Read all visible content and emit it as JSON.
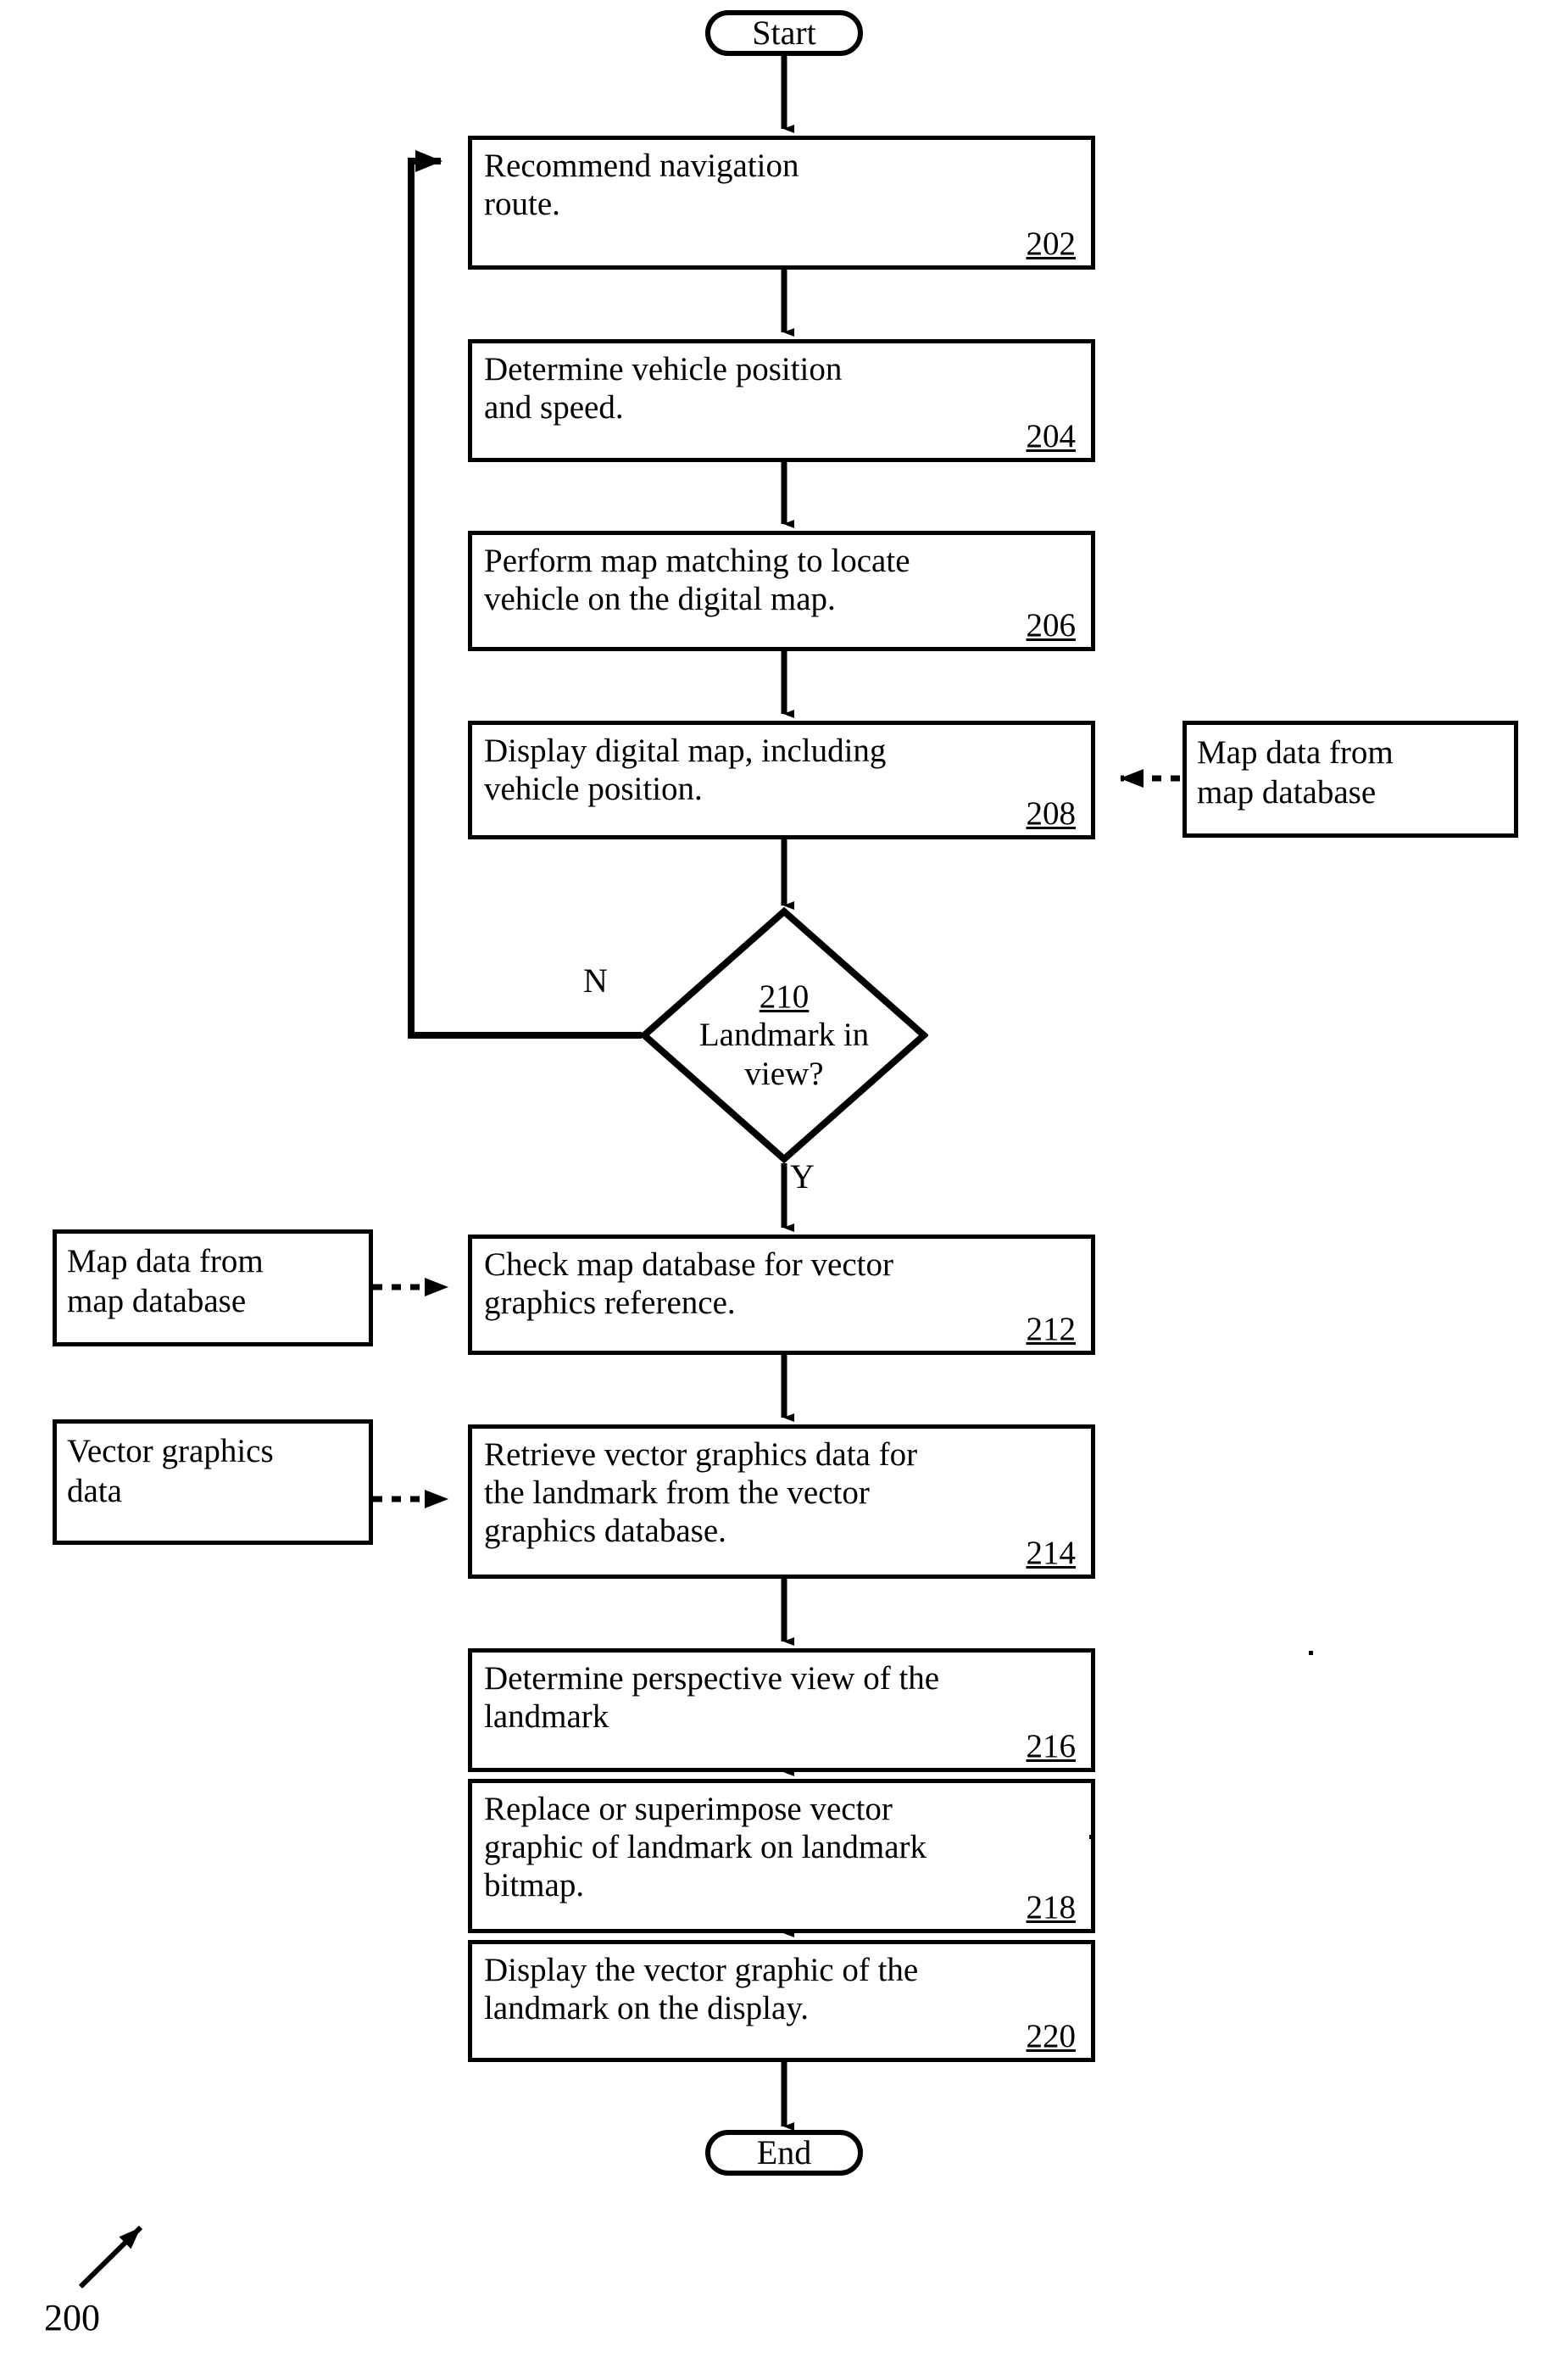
{
  "figure": {
    "label": "200",
    "caption_arrow": "figure-callout-arrow"
  },
  "nodes": {
    "start": {
      "label": "Start",
      "type": "terminator"
    },
    "end": {
      "label": "End",
      "type": "terminator"
    },
    "step202": {
      "text": "Recommend navigation\nroute.",
      "ref": "202",
      "type": "process"
    },
    "step204": {
      "text": "Determine vehicle position\nand speed.",
      "ref": "204",
      "type": "process"
    },
    "step206": {
      "text": "Perform map matching to locate\nvehicle on the digital map.",
      "ref": "206",
      "type": "process"
    },
    "step208": {
      "text": "Display digital map, including\nvehicle position.",
      "ref": "208",
      "type": "process"
    },
    "decision210": {
      "ref": "210",
      "question": "Landmark in\nview?",
      "type": "decision",
      "yes_label": "Y",
      "no_label": "N"
    },
    "step212": {
      "text": "Check map database for vector\ngraphics reference.",
      "ref": "212",
      "type": "process"
    },
    "step214": {
      "text": "Retrieve vector graphics data for\nthe landmark from the vector\ngraphics database.",
      "ref": "214",
      "type": "process"
    },
    "step216": {
      "text": "Determine perspective view of the\nlandmark",
      "ref": "216",
      "type": "process"
    },
    "step218": {
      "text": "Replace or superimpose vector\ngraphic of landmark on landmark\nbitmap.",
      "ref": "218",
      "type": "process"
    },
    "step220": {
      "text": "Display the vector graphic of the\nlandmark on the display.",
      "ref": "220",
      "type": "process"
    }
  },
  "annotations": {
    "map_data_right": {
      "text": "Map data from\nmap database"
    },
    "map_data_left": {
      "text": "Map data from\nmap database"
    },
    "vector_graphics_data": {
      "text": "Vector graphics\ndata"
    }
  },
  "style": {
    "stroke": "#000000",
    "fill": "#ffffff"
  }
}
